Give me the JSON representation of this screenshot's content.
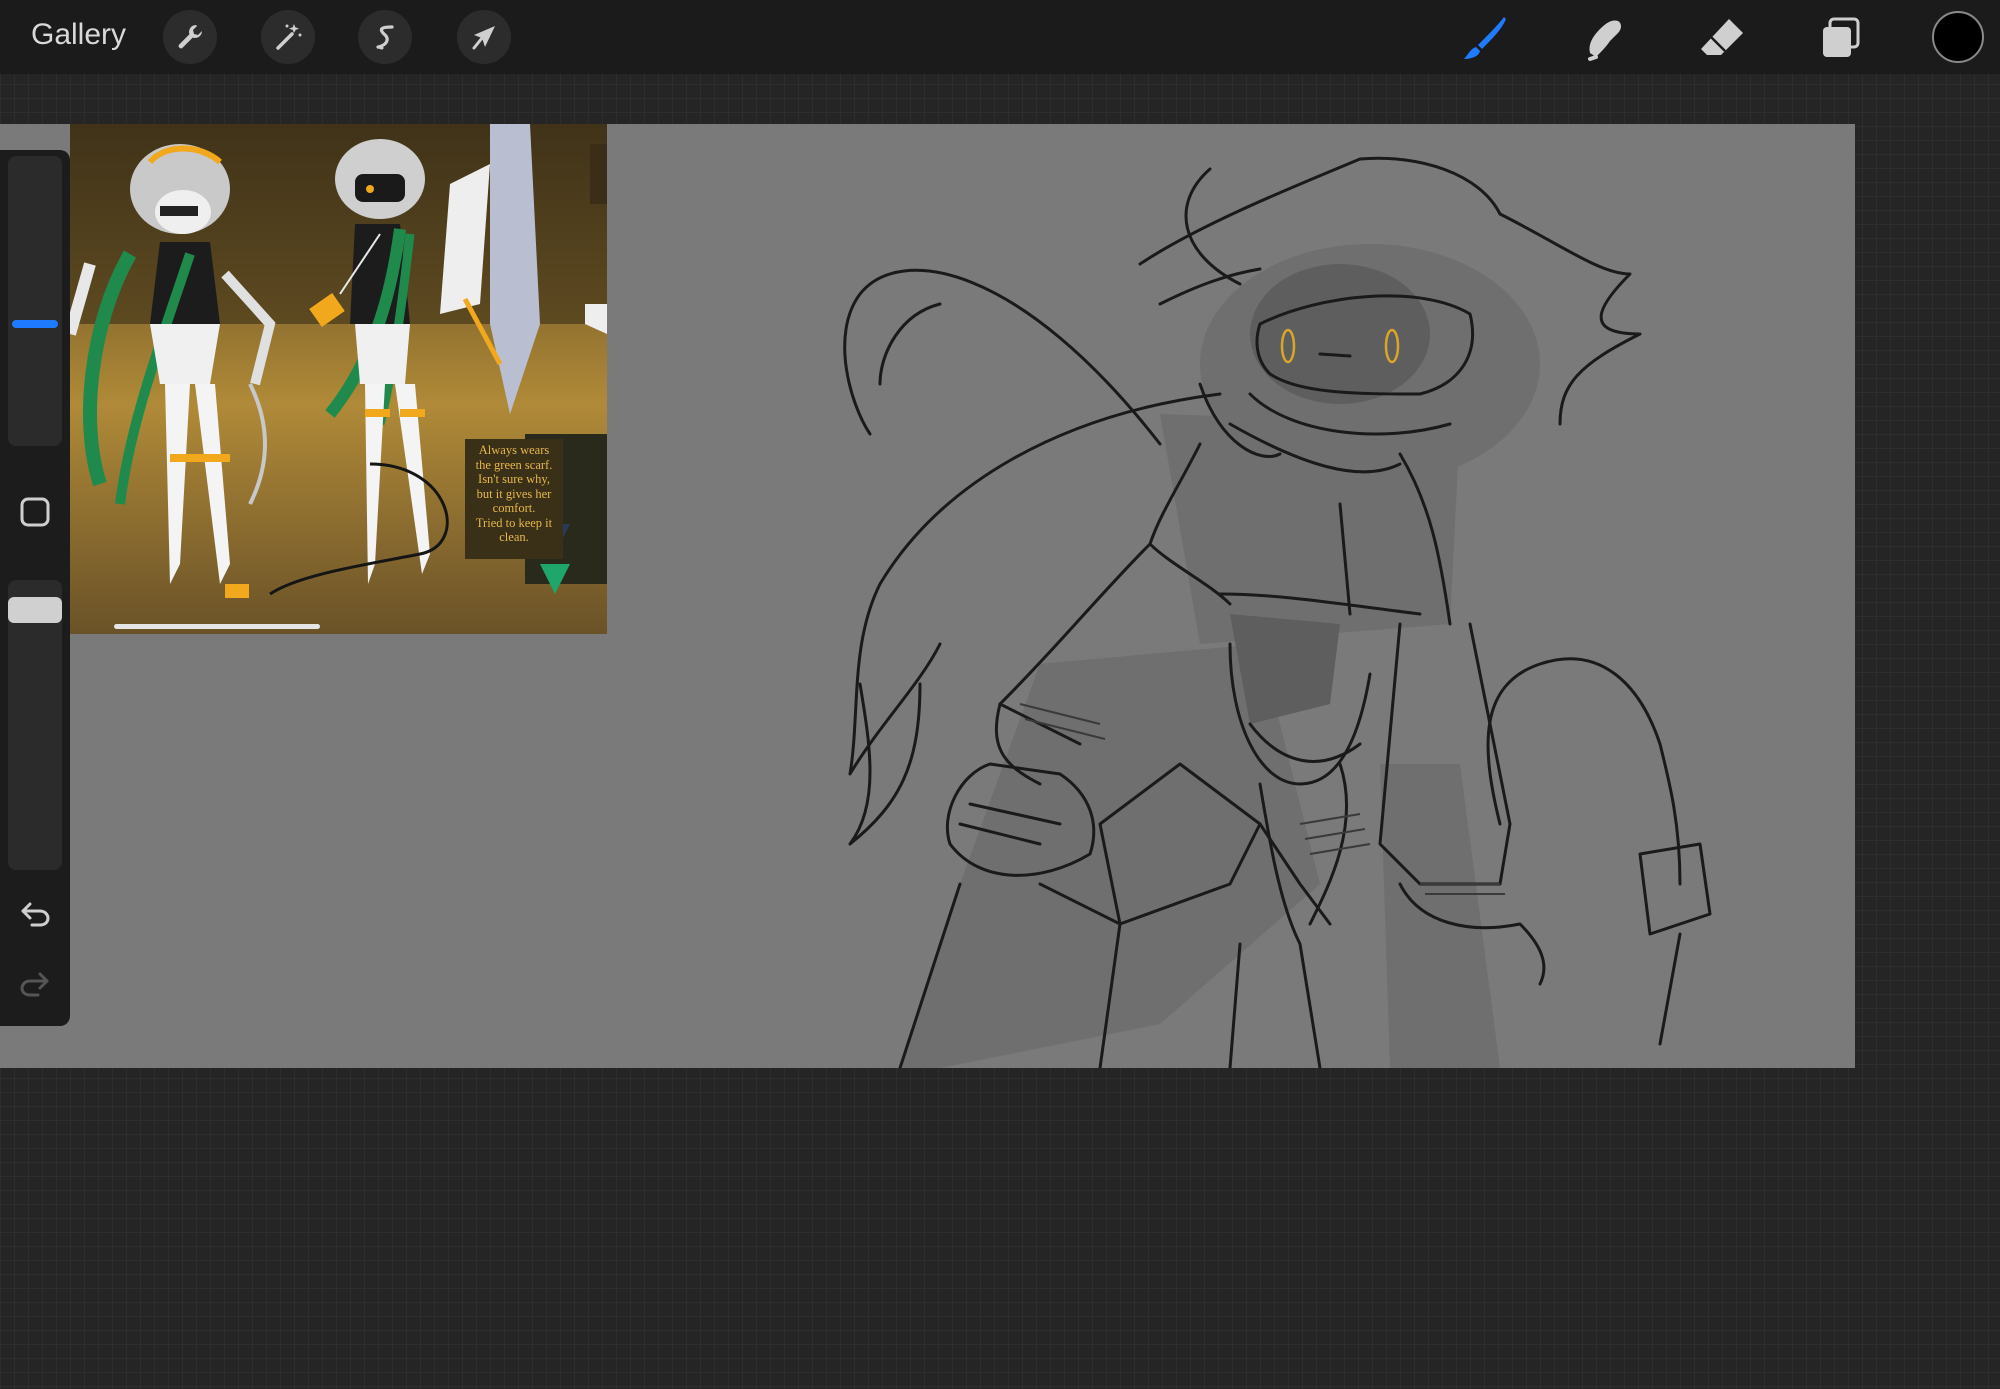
{
  "toolbar": {
    "gallery_label": "Gallery",
    "left_tools": [
      {
        "name": "actions",
        "icon": "wrench-icon"
      },
      {
        "name": "adjustments",
        "icon": "magic-wand-icon"
      },
      {
        "name": "selection",
        "icon": "selection-s-icon"
      },
      {
        "name": "transform",
        "icon": "arrow-cursor-icon"
      }
    ],
    "right_tools": [
      {
        "name": "brush",
        "icon": "brush-icon",
        "active": true
      },
      {
        "name": "smudge",
        "icon": "smudge-finger-icon",
        "active": false
      },
      {
        "name": "eraser",
        "icon": "eraser-icon",
        "active": false
      },
      {
        "name": "layers",
        "icon": "layers-icon",
        "active": false
      }
    ],
    "current_color": "#000000",
    "active_color": "#1e7bff"
  },
  "sidebar": {
    "brush_size_level": 0.35,
    "opacity_level": 0.05,
    "modify_button_icon": "square-icon",
    "undo_icon": "undo-icon",
    "redo_icon": "redo-icon"
  },
  "reference": {
    "note_lines": [
      "Always wears",
      "the green scarf.",
      "Isn't sure why,",
      "but it gives her",
      "comfort.",
      "Tried to keep it",
      "clean."
    ]
  },
  "colors": {
    "canvas_gray": "#7a7a7a",
    "scarf_green": "#1f8a4c",
    "accent_orange": "#f2a81d"
  }
}
